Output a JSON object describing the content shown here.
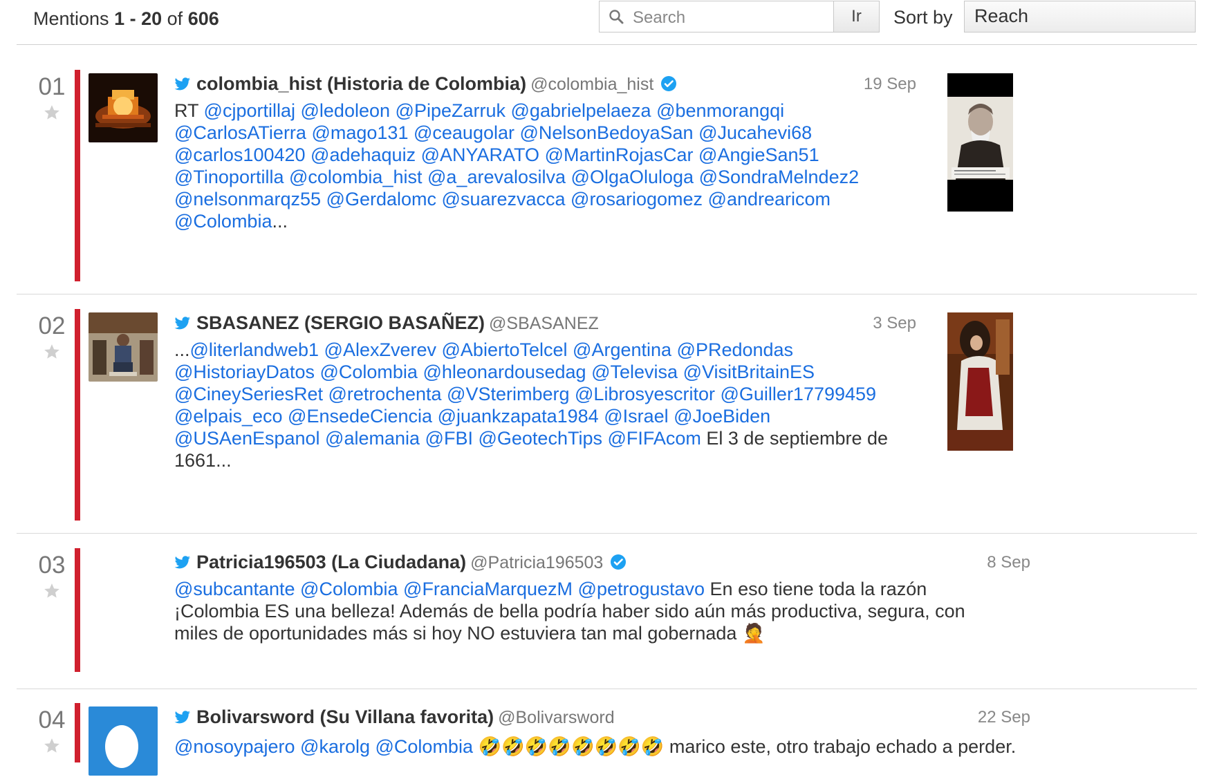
{
  "header": {
    "mentions_label": "Mentions",
    "range": "1 - 20",
    "of_label": "of",
    "total": "606",
    "search_placeholder": "Search",
    "go_label": "Ir",
    "sort_label": "Sort by",
    "sort_value": "Reach"
  },
  "colors": {
    "accent_bar": "#d0202e",
    "link": "#1a6ee0",
    "twitter": "#1da1f2",
    "verified": "#1da1f2"
  },
  "mentions": [
    {
      "rank": "01",
      "author": "colombia_hist (Historia de Colombia)",
      "handle": "@colombia_hist",
      "verified": true,
      "date": "19 Sep",
      "lines": [
        [
          {
            "t": "RT ",
            "link": false
          },
          {
            "t": "@cjportillaj",
            "link": true
          },
          {
            "t": " ",
            "link": false
          },
          {
            "t": "@ledoleon",
            "link": true
          },
          {
            "t": " ",
            "link": false
          },
          {
            "t": "@PipeZarruk",
            "link": true
          },
          {
            "t": " ",
            "link": false
          },
          {
            "t": "@gabrielpelaeza",
            "link": true
          },
          {
            "t": " ",
            "link": false
          },
          {
            "t": "@benmorangqi",
            "link": true
          }
        ],
        [
          {
            "t": "@CarlosATierra",
            "link": true
          },
          {
            "t": " ",
            "link": false
          },
          {
            "t": "@mago131",
            "link": true
          },
          {
            "t": " ",
            "link": false
          },
          {
            "t": "@ceaugolar",
            "link": true
          },
          {
            "t": " ",
            "link": false
          },
          {
            "t": "@NelsonBedoyaSan",
            "link": true
          },
          {
            "t": " ",
            "link": false
          },
          {
            "t": "@Jucahevi68",
            "link": true
          }
        ],
        [
          {
            "t": "@carlos100420",
            "link": true
          },
          {
            "t": " ",
            "link": false
          },
          {
            "t": "@adehaquiz",
            "link": true
          },
          {
            "t": " ",
            "link": false
          },
          {
            "t": "@ANYARATO",
            "link": true
          },
          {
            "t": " ",
            "link": false
          },
          {
            "t": "@MartinRojasCar",
            "link": true
          },
          {
            "t": " ",
            "link": false
          },
          {
            "t": "@AngieSan51",
            "link": true
          }
        ],
        [
          {
            "t": "@Tinoportilla",
            "link": true
          },
          {
            "t": " ",
            "link": false
          },
          {
            "t": "@colombia_hist",
            "link": true
          },
          {
            "t": " ",
            "link": false
          },
          {
            "t": "@a_arevalosilva",
            "link": true
          },
          {
            "t": " ",
            "link": false
          },
          {
            "t": "@OlgaOluloga",
            "link": true
          },
          {
            "t": " ",
            "link": false
          },
          {
            "t": "@SondraMelndez2",
            "link": true
          }
        ],
        [
          {
            "t": "@nelsonmarqz55",
            "link": true
          },
          {
            "t": " ",
            "link": false
          },
          {
            "t": "@Gerdalomc",
            "link": true
          },
          {
            "t": " ",
            "link": false
          },
          {
            "t": "@suarezvacca",
            "link": true
          },
          {
            "t": " ",
            "link": false
          },
          {
            "t": "@rosariogomez",
            "link": true
          },
          {
            "t": " ",
            "link": false
          },
          {
            "t": "@andrearicom",
            "link": true
          }
        ],
        [
          {
            "t": "@Colombia",
            "link": true
          },
          {
            "t": "...",
            "link": false
          }
        ]
      ],
      "avatar": "lamp-photo",
      "thumb": "portrait-photo"
    },
    {
      "rank": "02",
      "author": "SBASANEZ (SERGIO BASAÑEZ)",
      "handle": "@SBASANEZ",
      "verified": false,
      "date": "3 Sep",
      "lines": [
        [
          {
            "t": "...",
            "link": false
          },
          {
            "t": "@literlandweb1",
            "link": true
          },
          {
            "t": " ",
            "link": false
          },
          {
            "t": "@AlexZverev",
            "link": true
          },
          {
            "t": " ",
            "link": false
          },
          {
            "t": "@AbiertoTelcel",
            "link": true
          },
          {
            "t": " ",
            "link": false
          },
          {
            "t": "@Argentina",
            "link": true
          },
          {
            "t": " ",
            "link": false
          },
          {
            "t": "@PRedondas",
            "link": true
          }
        ],
        [
          {
            "t": "@HistoriayDatos",
            "link": true
          },
          {
            "t": " ",
            "link": false
          },
          {
            "t": "@Colombia",
            "link": true
          },
          {
            "t": " ",
            "link": false
          },
          {
            "t": "@hleonardousedag",
            "link": true
          },
          {
            "t": " ",
            "link": false
          },
          {
            "t": "@Televisa",
            "link": true
          },
          {
            "t": " ",
            "link": false
          },
          {
            "t": "@VisitBritainES",
            "link": true
          }
        ],
        [
          {
            "t": "@CineySeriesRet",
            "link": true
          },
          {
            "t": " ",
            "link": false
          },
          {
            "t": "@retrochenta",
            "link": true
          },
          {
            "t": " ",
            "link": false
          },
          {
            "t": "@VSterimberg",
            "link": true
          },
          {
            "t": " ",
            "link": false
          },
          {
            "t": "@Librosyescritor",
            "link": true
          },
          {
            "t": " ",
            "link": false
          },
          {
            "t": "@Guiller17799459",
            "link": true
          }
        ],
        [
          {
            "t": "@elpais_eco",
            "link": true
          },
          {
            "t": " ",
            "link": false
          },
          {
            "t": "@EnsedeCiencia",
            "link": true
          },
          {
            "t": " ",
            "link": false
          },
          {
            "t": "@juankzapata1984",
            "link": true
          },
          {
            "t": " ",
            "link": false
          },
          {
            "t": "@Israel",
            "link": true
          },
          {
            "t": " ",
            "link": false
          },
          {
            "t": "@JoeBiden",
            "link": true
          }
        ],
        [
          {
            "t": "@USAenEspanol",
            "link": true
          },
          {
            "t": " ",
            "link": false
          },
          {
            "t": "@alemania",
            "link": true
          },
          {
            "t": " ",
            "link": false
          },
          {
            "t": "@FBI",
            "link": true
          },
          {
            "t": " ",
            "link": false
          },
          {
            "t": "@GeotechTips",
            "link": true
          },
          {
            "t": " ",
            "link": false
          },
          {
            "t": "@FIFAcom",
            "link": true
          },
          {
            "t": " El 3 de septiembre de",
            "link": false
          }
        ],
        [
          {
            "t": "1661...",
            "link": false
          }
        ]
      ],
      "avatar": "person-photo",
      "thumb": "painting-photo"
    },
    {
      "rank": "03",
      "author": "Patricia196503 (La Ciudadana)",
      "handle": "@Patricia196503",
      "verified": true,
      "date": "8 Sep",
      "lines": [
        [
          {
            "t": "@subcantante",
            "link": true
          },
          {
            "t": " ",
            "link": false
          },
          {
            "t": "@Colombia",
            "link": true
          },
          {
            "t": " ",
            "link": false
          },
          {
            "t": "@FranciaMarquezM",
            "link": true
          },
          {
            "t": " ",
            "link": false
          },
          {
            "t": "@petrogustavo",
            "link": true
          },
          {
            "t": " En eso tiene toda la razón",
            "link": false
          }
        ],
        [
          {
            "t": "¡Colombia ES una belleza! Además de bella podría haber sido aún más productiva, segura, con",
            "link": false
          }
        ],
        [
          {
            "t": "miles de oportunidades más si hoy NO estuviera tan mal gobernada 🤦",
            "link": false
          }
        ]
      ]
    },
    {
      "rank": "04",
      "author": "Bolivarsword (Su Villana favorita)",
      "handle": "@Bolivarsword",
      "verified": false,
      "date": "22 Sep",
      "lines": [
        [
          {
            "t": "@nosoypajero",
            "link": true
          },
          {
            "t": " ",
            "link": false
          },
          {
            "t": "@karolg",
            "link": true
          },
          {
            "t": " ",
            "link": false
          },
          {
            "t": "@Colombia",
            "link": true
          },
          {
            "t": " 🤣🤣🤣🤣🤣🤣🤣🤣 marico este, otro trabajo echado a perder.",
            "link": false
          }
        ]
      ],
      "avatar": "egg-avatar"
    }
  ]
}
